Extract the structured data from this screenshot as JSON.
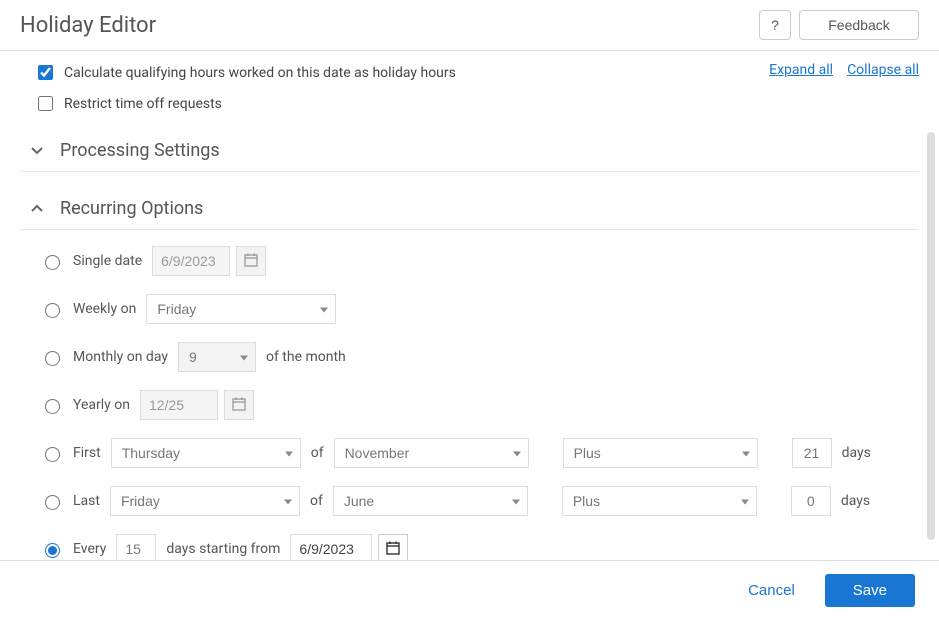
{
  "header": {
    "title": "Holiday Editor",
    "help": "?",
    "feedback": "Feedback"
  },
  "links": {
    "expand": "Expand all",
    "collapse": "Collapse all"
  },
  "checkboxes": {
    "calc_label": "Calculate qualifying hours worked on this date as holiday hours",
    "restrict_label": "Restrict time off requests"
  },
  "sections": {
    "processing": "Processing Settings",
    "recurring": "Recurring Options"
  },
  "recurring": {
    "single": {
      "label": "Single date",
      "value": "6/9/2023"
    },
    "weekly": {
      "label": "Weekly on",
      "value": "Friday"
    },
    "monthly": {
      "label": "Monthly on day",
      "value": "9",
      "suffix": "of the month"
    },
    "yearly": {
      "label": "Yearly on",
      "value": "12/25"
    },
    "first": {
      "label": "First",
      "dow": "Thursday",
      "of": "of",
      "month": "November",
      "plus": "Plus",
      "days": "21",
      "days_label": "days"
    },
    "last": {
      "label": "Last",
      "dow": "Friday",
      "of": "of",
      "month": "June",
      "plus": "Plus",
      "days": "0",
      "days_label": "days"
    },
    "every": {
      "label": "Every",
      "n": "15",
      "mid": "days starting from",
      "date": "6/9/2023"
    }
  },
  "footer": {
    "cancel": "Cancel",
    "save": "Save"
  }
}
